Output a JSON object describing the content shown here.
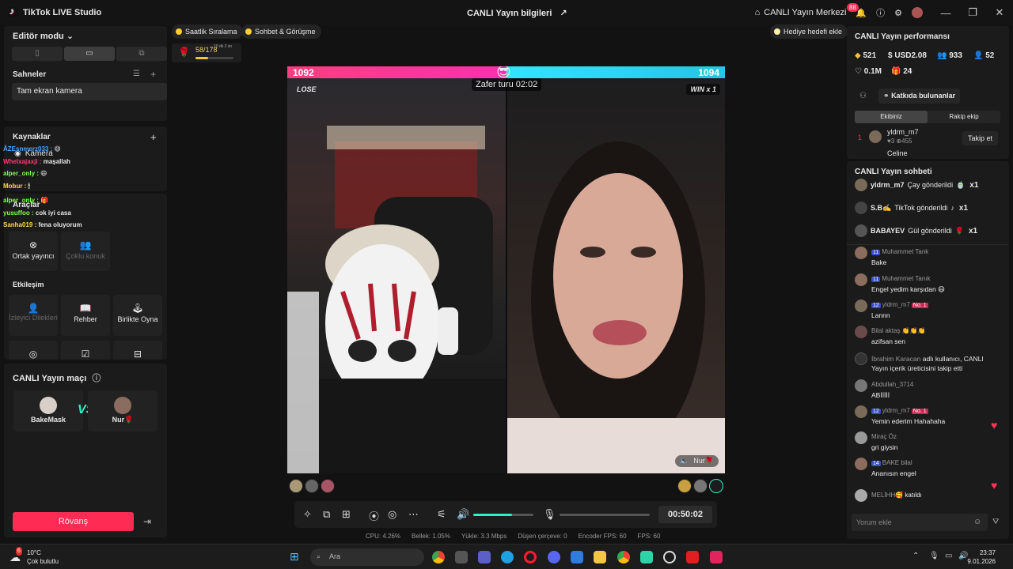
{
  "titlebar": {
    "app_name": "TikTok LIVE Studio",
    "center_title": "CANLI Yayın bilgileri",
    "live_center": "CANLI Yayın Merkezi",
    "notif_count": "88"
  },
  "editor": {
    "mode_label": "Editör modu",
    "scenes_label": "Sahneler",
    "scene_item": "Tam ekran kamera",
    "sources_label": "Kaynaklar",
    "source_item": "Kamera",
    "tools_label": "Araçlar",
    "tools": [
      "Ortak yayıncı",
      "Çoklu konuk"
    ],
    "interaction_label": "Etkileşim",
    "interaction_tools": [
      "İzleyici Dilekleri",
      "Rehber",
      "Birlikte Oyna"
    ]
  },
  "overlay_chat": [
    {
      "user": "ÂZEsnmerz033 :",
      "text": ""
    },
    {
      "user": "Whelxajaxji :",
      "text": "maşallah"
    },
    {
      "user": "alper_only :",
      "text": ""
    },
    {
      "user": "Mobur :",
      "text": ""
    },
    {
      "user": "alper_only :",
      "text": ""
    },
    {
      "user": "yusuffoo :",
      "text": "cok iyi casa"
    },
    {
      "user": "Sanha019 :",
      "text": "fena oluyorum"
    }
  ],
  "match": {
    "title": "CANLI Yayın maçı",
    "player1": "BakeMask",
    "player2": "Nur🌹",
    "vs": "VS",
    "rematch": "Rövanş"
  },
  "center": {
    "pill1": "Saatlik Sıralama",
    "pill2": "Sohbet & Görüşme",
    "gift_goal_btn": "Hediye hedefi ekle",
    "goal_progress": "58/178",
    "goal_time": "10 dk 2 sn",
    "goal_fraction": 0.33
  },
  "battle": {
    "score_left": "1092",
    "score_right": "1094",
    "timer": "Zafer turu 02:02",
    "result_left": "LOSE",
    "result_right": "WIN x 1",
    "guest_label": "Nur🌹",
    "left_share": 0.5
  },
  "controls": {
    "elapsed": "00:50:02",
    "volume": 0.65
  },
  "stats": [
    "CPU: 4.26%",
    "Bellek: 1.05%",
    "Yükle: 3.3 Mbps",
    "Düşen çerçeve: 0",
    "Encoder FPS: 60",
    "FPS: 60"
  ],
  "performance": {
    "title": "CANLI Yayın performansı",
    "diamonds": "521",
    "usd": "USD2.08",
    "viewers": "933",
    "new_followers": "52",
    "likes": "0.1M",
    "gifters": "24",
    "contributors_label": "Katkıda bulunanlar",
    "tab_mine": "Ekibiniz",
    "tab_rival": "Rakip ekip",
    "top1_rank": "1",
    "top1_name": "yldrm_m7",
    "top1_stats": "♥3  ⊕455",
    "top2_name": "Celine",
    "follow_btn": "Takip et"
  },
  "chat": {
    "title": "CANLI Yayın sohbeti",
    "gifts": [
      {
        "user": "yldrm_m7",
        "text": "Çay gönderildi",
        "count": "x1"
      },
      {
        "user": "S.B✍️",
        "text": "TikTok gönderildi",
        "count": "x1"
      },
      {
        "user": "BABAYEV",
        "text": "Gül gönderildi",
        "count": "x1"
      }
    ],
    "messages": [
      {
        "level": "11",
        "name": "Muhammet Tank",
        "badge": "",
        "text": "Bake"
      },
      {
        "level": "11",
        "name": "Muhammet Tanık",
        "badge": "",
        "text": "Engel yedim karşıdan 😄"
      },
      {
        "level": "12",
        "name": "yldrm_m7",
        "badge": "No. 1",
        "text": "Lannn"
      },
      {
        "level": "",
        "name": "Bilal aktaş 👏👏👏",
        "badge": "",
        "text": "azifsan sen"
      },
      {
        "level": "",
        "name": "İbrahim Karacan",
        "badge": "",
        "text": "adlı kullanıcı, CANLI Yayın içerik üreticisini takip etti"
      },
      {
        "level": "",
        "name": "Abdullah_3714",
        "badge": "",
        "text": "ABİİİİİ"
      },
      {
        "level": "12",
        "name": "yldrm_m7",
        "badge": "No. 1",
        "text": "Yemin ederim Hahahaha"
      },
      {
        "level": "",
        "name": "Miraç Öz",
        "badge": "",
        "text": "gri giysin"
      },
      {
        "level": "14",
        "name": "BAKE bilal",
        "badge": "",
        "text": "Ananısın engel"
      },
      {
        "level": "",
        "name": "MELİHH🥰",
        "badge": "",
        "text": "katıldı"
      }
    ],
    "comment_placeholder": "Yorum ekle"
  },
  "taskbar": {
    "temp": "10°C",
    "weather": "Çok bulutlu",
    "weather_badge": "6",
    "search": "Ara",
    "time": "23:37",
    "date": "9.01.2026"
  }
}
